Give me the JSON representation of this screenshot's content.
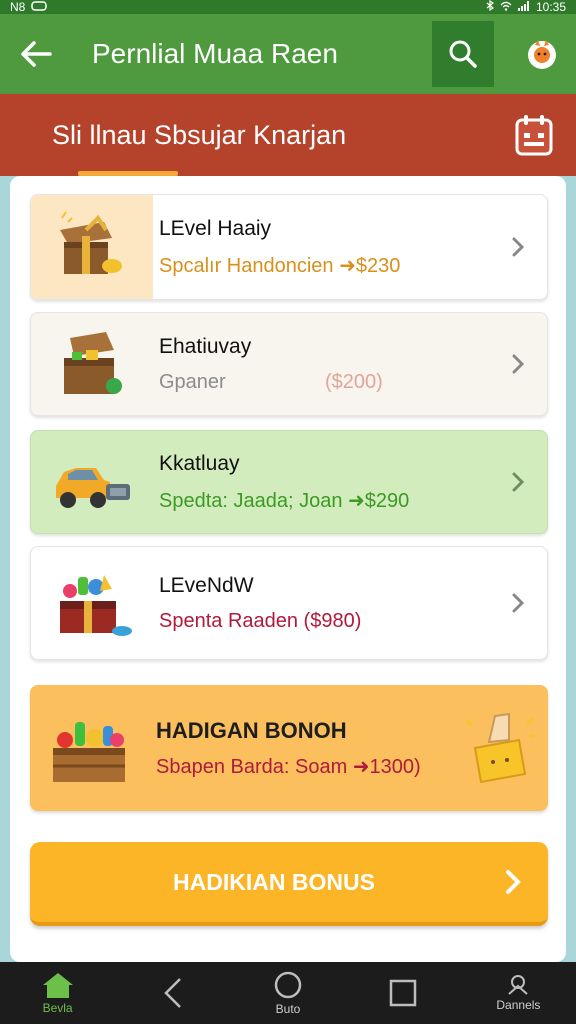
{
  "status_bar": {
    "left_text": "N8",
    "time": "10:35"
  },
  "app_bar": {
    "title": "Pernlial Muaa Raen"
  },
  "sub_bar": {
    "title": "Sli llnau Sbsujar Knarjan"
  },
  "cards": [
    {
      "name": "LEvel Haaiy",
      "detail": "Spcalır Handoncien ➜$230",
      "detail_color": "#d8901c",
      "bg": "#ffffff",
      "thumb_bg": "#fde7c2",
      "icon": "treasure-chest-icon"
    },
    {
      "name": "Ehatiuvay",
      "detail_left": "Gpaner",
      "detail_right": "($200)",
      "bg": "#f7f5ee",
      "icon": "chest-with-gems-icon"
    },
    {
      "name": "Kkatluay",
      "detail": "Spedta: Jaada; Joan ➜$290",
      "detail_color": "#3c9a24",
      "bg": "#d3ecbe",
      "icon": "toy-car-icon"
    },
    {
      "name": "LEveNdW",
      "detail": "Spenta Raaden  ($980)",
      "detail_color": "#b11a3a",
      "bg": "#ffffff",
      "icon": "candy-chest-icon"
    }
  ],
  "bonus_card": {
    "title": "HADIGAN BONOH",
    "detail": "Sbapen Barda: Soam ➜1300)"
  },
  "cta": {
    "label": "HADIKIAN BONUS"
  },
  "nav": [
    {
      "label": "Bevla",
      "icon": "home-icon"
    },
    {
      "label": "",
      "icon": "back-icon"
    },
    {
      "label": "Buto",
      "icon": "home-circle-icon"
    },
    {
      "label": "",
      "icon": "recents-icon"
    },
    {
      "label": "Dannels",
      "icon": "channels-icon"
    }
  ],
  "colors": {
    "app_bar": "#4f9a3f",
    "sub_bar": "#b5432c",
    "accent": "#fbb526",
    "nav_active": "#6cc04a"
  }
}
